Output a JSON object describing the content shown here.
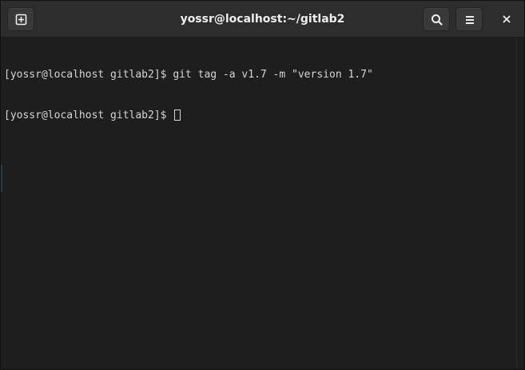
{
  "window": {
    "title": "yossr@localhost:~/gitlab2"
  },
  "header": {
    "new_tab_icon": "new-tab-icon",
    "search_icon": "search-icon",
    "menu_icon": "hamburger-menu-icon",
    "close_icon": "close-icon"
  },
  "terminal": {
    "lines": [
      "[yossr@localhost gitlab2]$ git tag -a v1.7 -m \"version 1.7\"",
      "[yossr@localhost gitlab2]$ "
    ]
  },
  "colors": {
    "background": "#1e1e1e",
    "titlebar": "#2d2d2d",
    "text": "#d3d7cf"
  }
}
